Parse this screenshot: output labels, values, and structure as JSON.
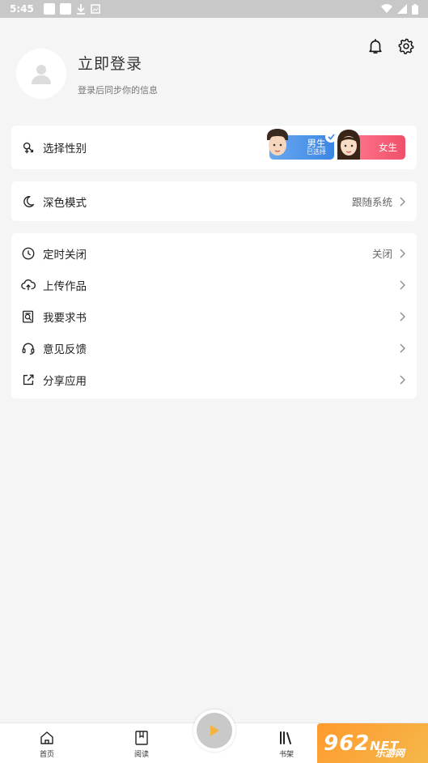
{
  "status_bar": {
    "time": "5:45"
  },
  "profile": {
    "title": "立即登录",
    "subtitle": "登录后同步你的信息"
  },
  "gender": {
    "label": "选择性别",
    "male": {
      "label": "男生",
      "sub": "已选择"
    },
    "female": {
      "label": "女生"
    }
  },
  "dark_mode": {
    "label": "深色模式",
    "value": "跟随系统"
  },
  "menu": [
    {
      "label": "定时关闭",
      "value": "关闭",
      "icon": "clock-icon"
    },
    {
      "label": "上传作品",
      "value": "",
      "icon": "cloud-upload-icon"
    },
    {
      "label": "我要求书",
      "value": "",
      "icon": "book-search-icon"
    },
    {
      "label": "意见反馈",
      "value": "",
      "icon": "headset-icon"
    },
    {
      "label": "分享应用",
      "value": "",
      "icon": "share-icon"
    }
  ],
  "bottom_nav": {
    "home": "首页",
    "read": "阅读",
    "shelf": "书架"
  },
  "watermark": {
    "number": "962",
    "net": "NET",
    "text": "乐游网"
  },
  "colors": {
    "male_accent": "#3a86e4",
    "female_accent": "#f0506a",
    "play_icon": "#f5b342"
  }
}
